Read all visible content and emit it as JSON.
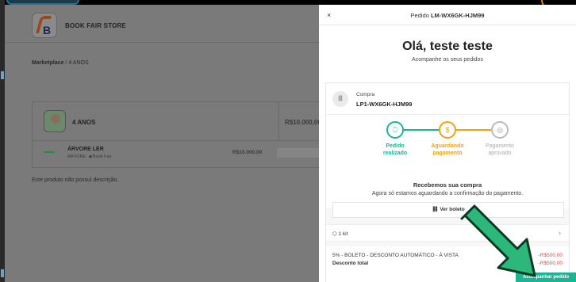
{
  "store": {
    "name": "BOOK FAIR STORE",
    "logo_letter": "B"
  },
  "breadcrumb": {
    "root": "Marketplace",
    "separator": "/",
    "current": "4 ANOS"
  },
  "product": {
    "name": "4 ANOS",
    "price": "R$10.000,00",
    "sub_item": {
      "title": "ÁRVORE LER",
      "meta_brand": "ARVORE",
      "meta_store": "Book Fair",
      "price": "R$10.000,00"
    },
    "description": "Este produto não possui descrição."
  },
  "panel": {
    "close_glyph": "×",
    "title_prefix": "Pedido",
    "order_id": "LM-WX6GK-HJM99",
    "greeting": "Olá, teste teste",
    "greeting_sub": "Acompanhe os seus pedidos",
    "purchase_label": "Compra",
    "purchase_code": "LP1-WX6GK-HJM99",
    "steps": [
      {
        "label_1": "Pedido",
        "label_2": "realizado",
        "state": "done",
        "icon": "receipt-icon"
      },
      {
        "label_1": "Aguardando",
        "label_2": "pagamento",
        "state": "pending",
        "icon": "money-icon"
      },
      {
        "label_1": "Pagamento",
        "label_2": "aprovado",
        "state": "future",
        "icon": "money-icon"
      }
    ],
    "info_title": "Recebemos sua compra",
    "info_text": "Agora só estamos aguardando a confirmação do pagamento.",
    "boleto_button": "Ver boleto",
    "kit_label": "1 kit",
    "discount_label": "5% - BOLETO - DESCONTO AUTOMÁTICO - À VISTA",
    "discount_value": "-R$500,00",
    "total_discount_label": "Desconto total",
    "total_discount_value": "-R$500,00",
    "cta": "Acompanhar pedido"
  },
  "colors": {
    "accent": "#1cb494",
    "pending": "#f4a016",
    "future": "#aaaaaa",
    "negative": "#e04848",
    "overlay_arrow": "#2bb87a"
  }
}
